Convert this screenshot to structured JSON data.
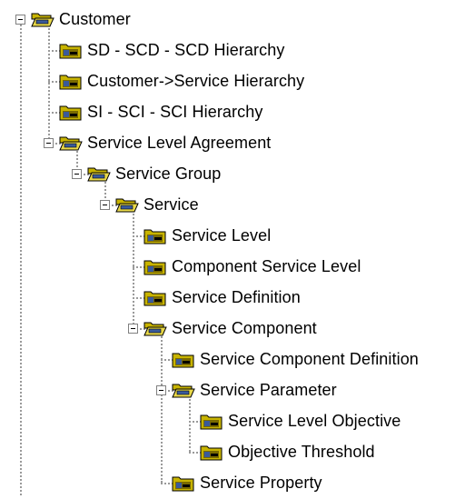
{
  "nodes": [
    {
      "label": "Customer",
      "type": "folder-open",
      "expanded": true,
      "depth": 0
    },
    {
      "label": "SD - SCD - SCD Hierarchy",
      "type": "folder-closed",
      "depth": 1
    },
    {
      "label": "Customer->Service Hierarchy",
      "type": "folder-closed",
      "depth": 1
    },
    {
      "label": "SI - SCI - SCI Hierarchy",
      "type": "folder-closed",
      "depth": 1
    },
    {
      "label": "Service Level Agreement",
      "type": "folder-open",
      "expanded": true,
      "depth": 1
    },
    {
      "label": "Service Group",
      "type": "folder-open",
      "expanded": true,
      "depth": 2
    },
    {
      "label": "Service",
      "type": "folder-open",
      "expanded": true,
      "depth": 3
    },
    {
      "label": "Service Level",
      "type": "folder-closed",
      "depth": 4
    },
    {
      "label": "Component Service Level",
      "type": "folder-closed",
      "depth": 4
    },
    {
      "label": "Service Definition",
      "type": "folder-closed",
      "depth": 4
    },
    {
      "label": "Service Component",
      "type": "folder-open",
      "expanded": true,
      "depth": 4
    },
    {
      "label": "Service Component Definition",
      "type": "folder-closed",
      "depth": 5
    },
    {
      "label": "Service Parameter",
      "type": "folder-open",
      "expanded": true,
      "depth": 5
    },
    {
      "label": "Service Level Objective",
      "type": "folder-closed",
      "depth": 6
    },
    {
      "label": "Objective Threshold",
      "type": "folder-closed",
      "depth": 6
    },
    {
      "label": "Service Property",
      "type": "folder-closed",
      "depth": 5
    }
  ],
  "icons": {
    "folder-open": "open-folder-icon",
    "folder-closed": "closed-folder-icon"
  },
  "colors": {
    "folder": "#c8b400",
    "folder_dark": "#7a6a00",
    "guide": "#9a9a9a"
  }
}
